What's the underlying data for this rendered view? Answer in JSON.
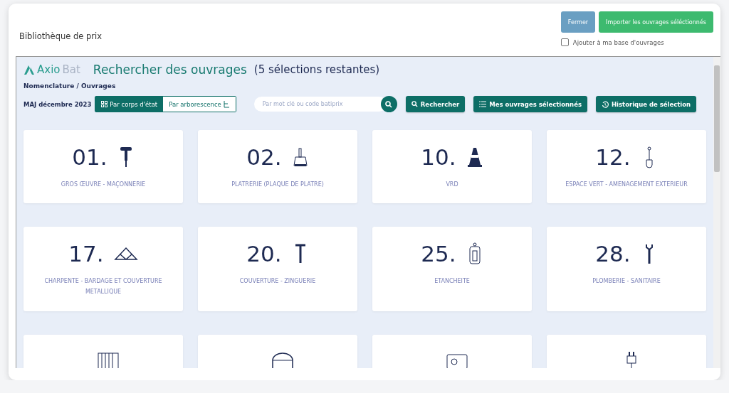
{
  "dialog": {
    "title": "Bibliothèque de prix",
    "buttons": [
      {
        "label": "Fermer",
        "kind": "secondary"
      },
      {
        "label": "Importer les ouvrages séléctionnés",
        "kind": "primary"
      }
    ],
    "option": {
      "label": "Ajouter à ma base d'ouvrages",
      "checked": false
    }
  },
  "logo": {
    "first": "Axio",
    "second": "Bat"
  },
  "heading": {
    "title": "Rechercher des ouvrages",
    "note": "(5 sélections restantes)"
  },
  "breadcrumb": "Nomenclature / Ouvrages",
  "update": "MAJ décembre 2023",
  "views": [
    {
      "label": "Par corps d'état",
      "selected": true,
      "kind": "grid"
    },
    {
      "label": "Par arborescence",
      "selected": false,
      "kind": "tree"
    }
  ],
  "search": {
    "placeholder": "Par mot clé ou code batiprix"
  },
  "actions": [
    {
      "label": "Rechercher",
      "kind": "search"
    },
    {
      "label": "Mes ouvrages sélectionnés",
      "kind": "list"
    },
    {
      "label": "Historique de sélection",
      "kind": "history"
    }
  ],
  "cards": [
    {
      "number": "01.",
      "label": "GROS ŒUVRE - MAÇONNERIE",
      "kind": "drill"
    },
    {
      "number": "02.",
      "label": "PLATRERIE (PLAQUE DE PLATRE)",
      "kind": "trowel"
    },
    {
      "number": "10.",
      "label": "VRD",
      "kind": "cone"
    },
    {
      "number": "12.",
      "label": "ESPACE VERT - AMENAGEMENT EXTERIEUR",
      "kind": "shovel"
    },
    {
      "number": "17.",
      "label": "CHARPENTE - BARDAGE ET COUVERTURE METALLIQUE",
      "kind": "truss"
    },
    {
      "number": "20.",
      "label": "COUVERTURE - ZINGUERIE",
      "kind": "hammer"
    },
    {
      "number": "25.",
      "label": "ETANCHEITE",
      "kind": "canister"
    },
    {
      "number": "28.",
      "label": "PLOMBERIE - SANITAIRE",
      "kind": "wrench"
    },
    {
      "kind": "radiator"
    },
    {
      "kind": "arch"
    },
    {
      "kind": "panel"
    },
    {
      "kind": "plug"
    }
  ]
}
